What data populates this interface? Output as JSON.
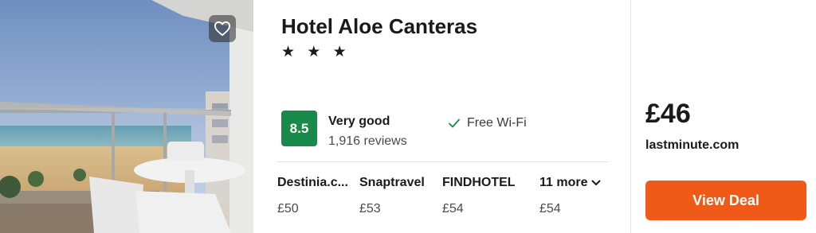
{
  "hotel": {
    "name": "Hotel Aloe Canteras",
    "stars": "★ ★ ★",
    "star_count": 3
  },
  "rating": {
    "score": "8.5",
    "label": "Very good",
    "reviews": "1,916 reviews",
    "badge_color": "#1a8a4a"
  },
  "amenities": [
    {
      "label": "Free Wi-Fi",
      "icon": "check-icon"
    }
  ],
  "providers": [
    {
      "name": "Destinia.c...",
      "price": "£50"
    },
    {
      "name": "Snaptravel",
      "price": "£53"
    },
    {
      "name": "FINDHOTEL",
      "price": "£54"
    },
    {
      "name": "11 more",
      "price": "£54",
      "icon": "chevron-down-icon"
    }
  ],
  "deal": {
    "price": "£46",
    "site": "lastminute.com",
    "button_label": "View Deal",
    "button_color": "#f05a18"
  },
  "photo": {
    "favorite_icon": "heart-icon"
  }
}
